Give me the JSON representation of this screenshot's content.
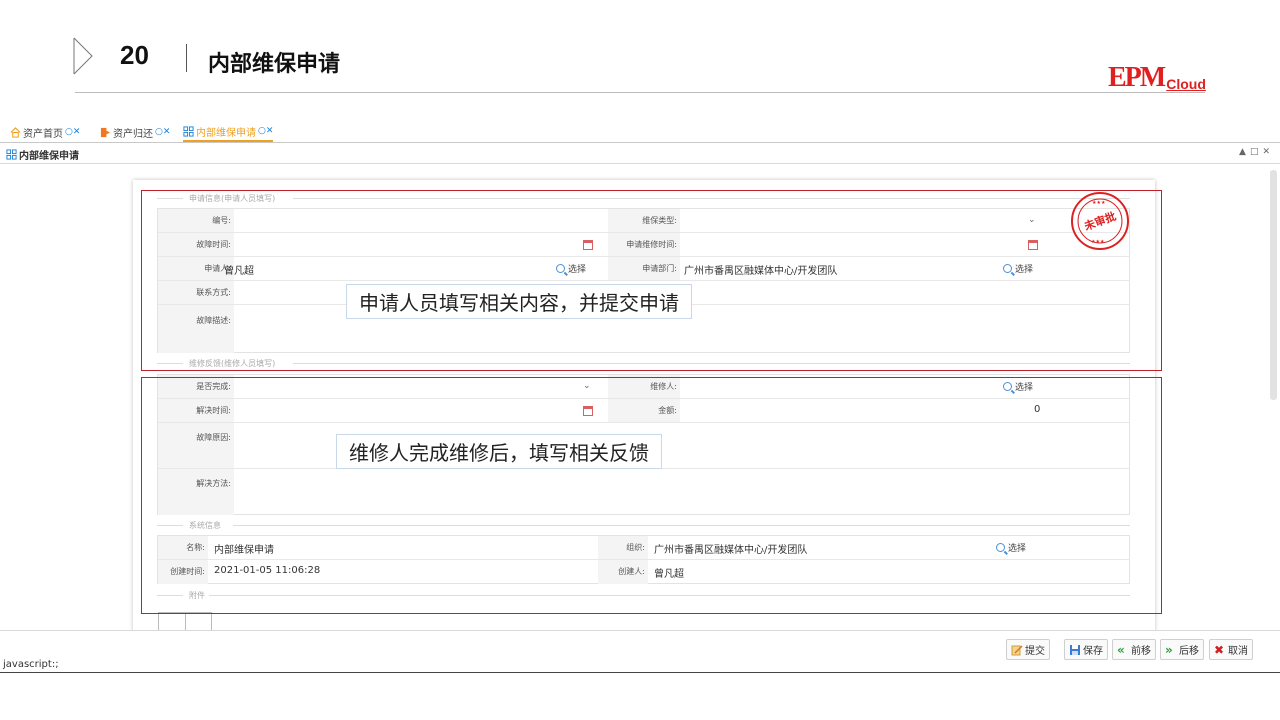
{
  "slide": {
    "number": "20",
    "title": "内部维保申请",
    "logo_main": "EPM",
    "logo_sub": "Cloud"
  },
  "tabs": [
    {
      "label": "资产首页"
    },
    {
      "label": "资产归还"
    },
    {
      "label": "内部维保申请"
    }
  ],
  "panel": {
    "title": "内部维保申请"
  },
  "sections": {
    "apply_legend": "申请信息(申请人员填写)",
    "repair_legend": "维修反馈(维修人员填写)",
    "system_legend": "系统信息",
    "attach_legend": "附件"
  },
  "apply": {
    "code_label": "编号:",
    "code_value": "",
    "type_label": "维保类型:",
    "type_value": "",
    "fault_time_label": "故障时间:",
    "req_time_label": "申请维修时间:",
    "applicant_label": "申请人:",
    "applicant_value": "曾凡超",
    "dept_label": "申请部门:",
    "dept_value": "广州市番禺区融媒体中心/开发团队",
    "contact_label": "联系方式:",
    "desc_label": "故障描述:",
    "select_label": "选择"
  },
  "repair": {
    "done_label": "是否完成:",
    "repairer_label": "维修人:",
    "solve_time_label": "解决时间:",
    "amount_label": "金额:",
    "amount_value": "0",
    "cause_label": "故障原因:",
    "method_label": "解决方法:",
    "select_label": "选择"
  },
  "system": {
    "name_label": "名称:",
    "name_value": "内部维保申请",
    "org_label": "组织:",
    "org_value": "广州市番禺区融媒体中心/开发团队",
    "created_label": "创建时间:",
    "created_value": "2021-01-05 11:06:28",
    "creator_label": "创建人:",
    "creator_value": "曾凡超",
    "select_label": "选择"
  },
  "callouts": {
    "apply_note": "申请人员填写相关内容，并提交申请",
    "repair_note": "维修人完成维修后，填写相关反馈"
  },
  "stamp": {
    "text": "未审批"
  },
  "buttons": {
    "submit": "提交",
    "save": "保存",
    "prev": "前移",
    "next": "后移",
    "cancel": "取消"
  },
  "status_text": "javascript:;",
  "colors": {
    "accent_tab": "#f0a020",
    "annotation_red": "#c0202a",
    "logo_red": "#e02020"
  }
}
